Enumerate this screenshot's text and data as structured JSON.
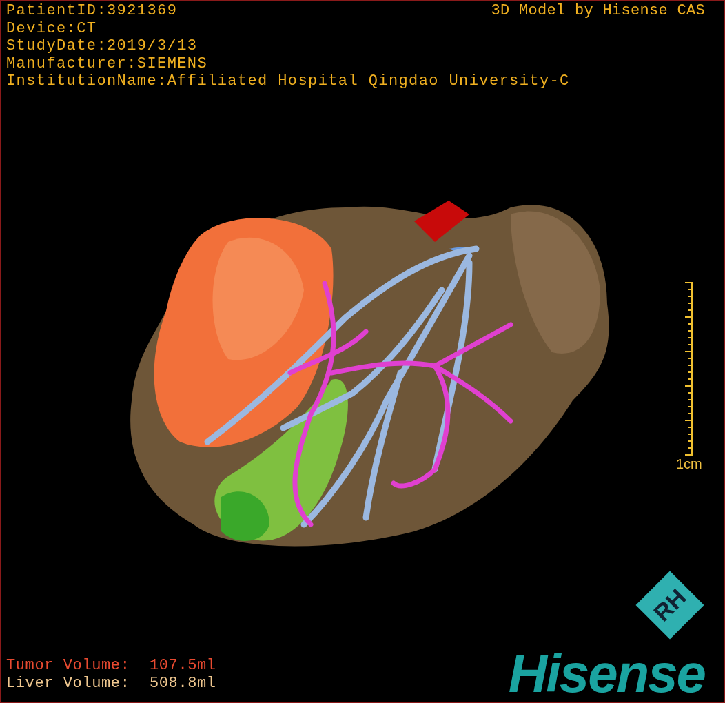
{
  "header_lines": [
    "PatientID:3921369",
    "Device:CT",
    "StudyDate:2019/3/13",
    "Manufacturer:SIEMENS",
    "InstitutionName:Affiliated Hospital Qingdao University-C"
  ],
  "title": "3D Model by Hisense CAS",
  "scale": {
    "label": "1cm"
  },
  "volumes": [
    {
      "kind": "tumor",
      "label": "Tumor Volume:",
      "value": "107.5ml"
    },
    {
      "kind": "liver",
      "label": "Liver Volume:",
      "value": "508.8ml"
    }
  ],
  "logo": {
    "mark": "RH",
    "name": "Hisense"
  }
}
